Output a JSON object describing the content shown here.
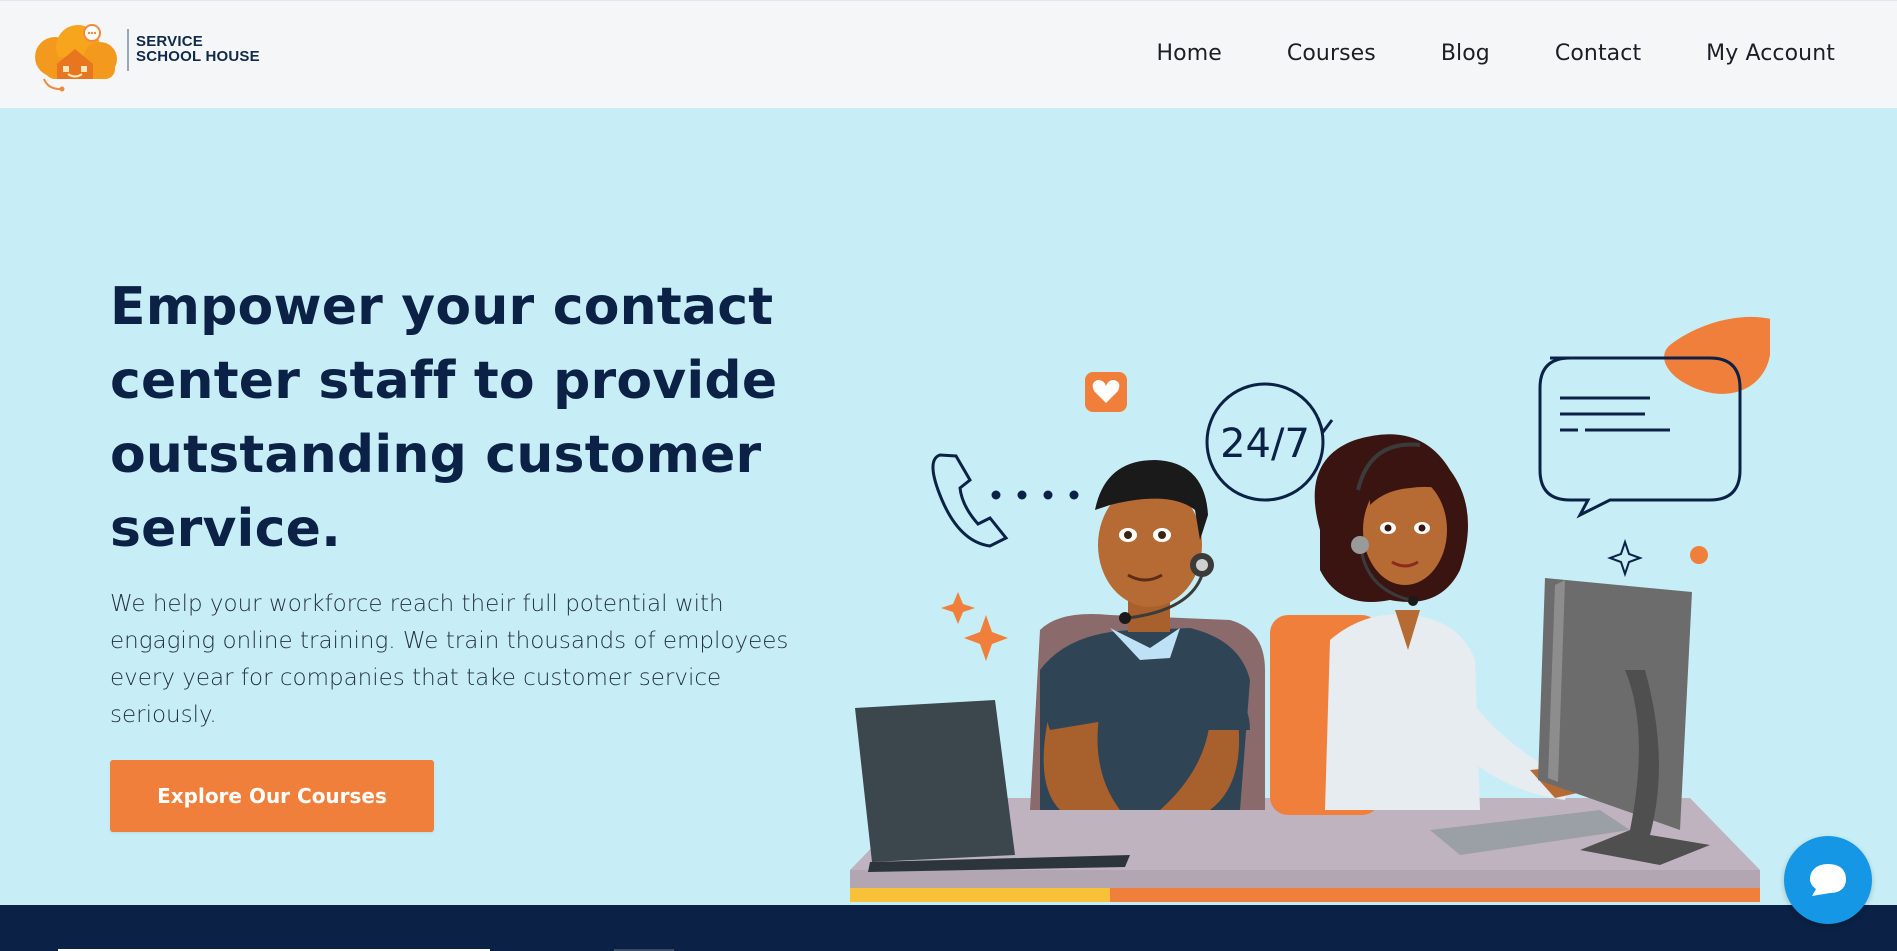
{
  "brand": {
    "name_line1": "Service",
    "name_line2": "School House"
  },
  "nav": {
    "items": [
      "Home",
      "Courses",
      "Blog",
      "Contact",
      "My Account"
    ]
  },
  "hero": {
    "title": "Empower your contact center staff to provide outstanding customer service.",
    "subtitle": "We help your workforce reach their full potential with engaging online training. We train thousands of employees every year for companies that take customer service seriously.",
    "cta_label": "Explore Our Courses"
  },
  "illustration": {
    "badge_text": "24/7"
  },
  "colors": {
    "accent": "#f07f3c",
    "background": "#c7eef6",
    "heading": "#0b2246",
    "chat": "#1597e5"
  },
  "icons": {
    "chat": "chat-bubble-icon",
    "phone": "phone-icon",
    "heart": "heart-icon",
    "speech": "speech-bubble-icon"
  }
}
